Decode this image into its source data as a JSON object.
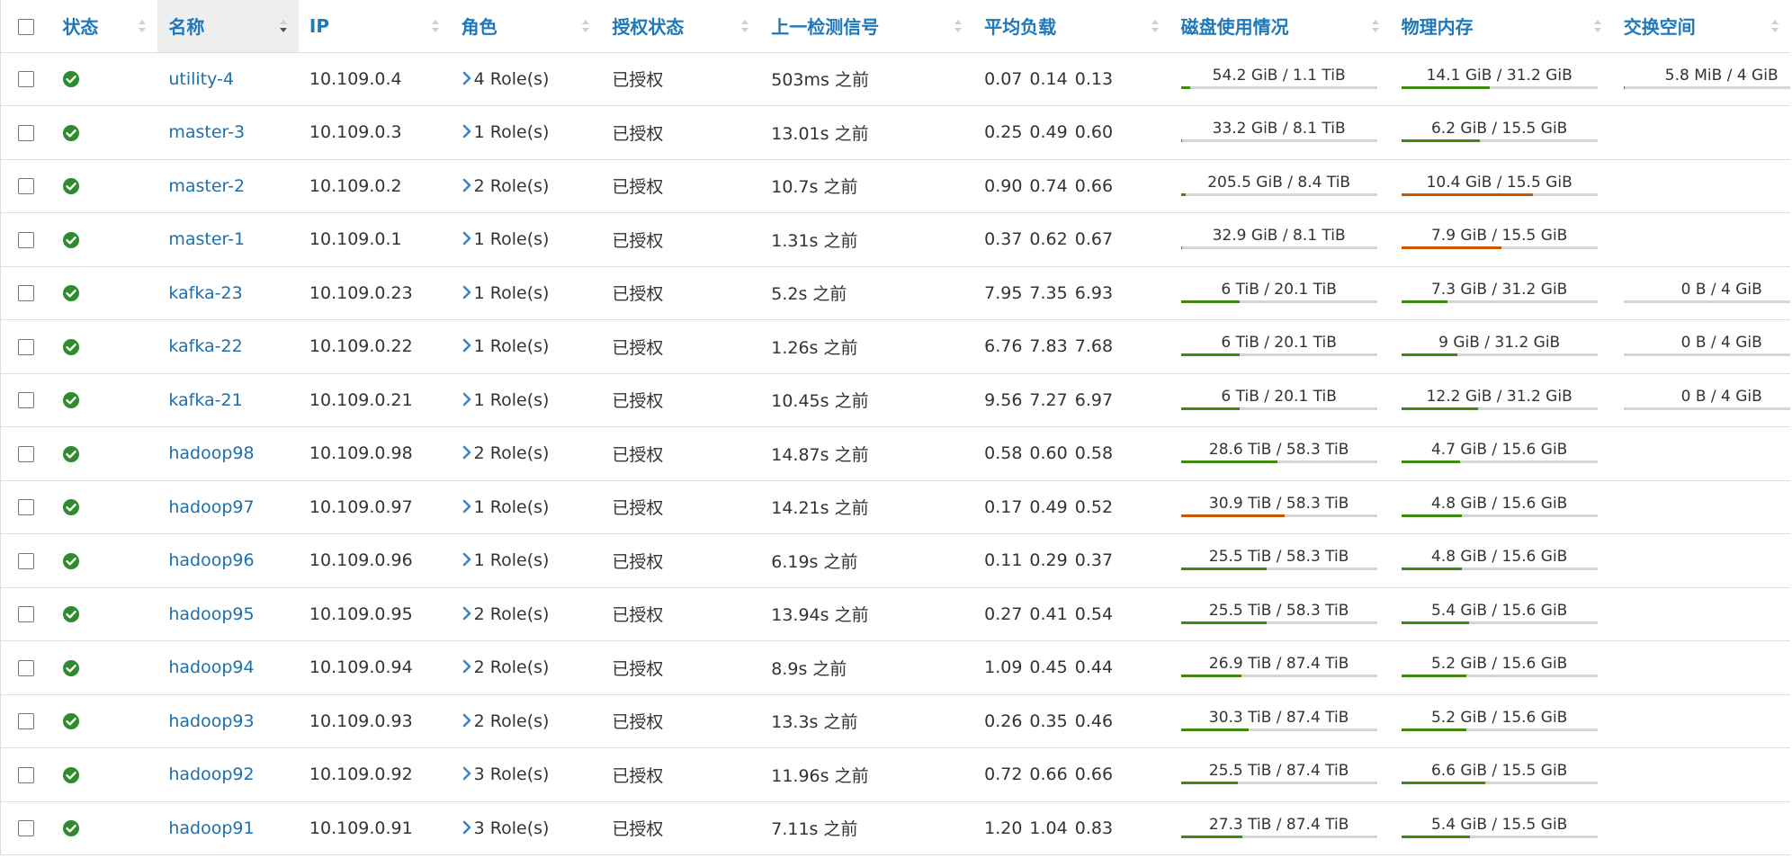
{
  "colors": {
    "header_text": "#1f78b8",
    "link": "#1f6fa8",
    "ok": "#2e8b2e",
    "bar_normal": "#3d8a0e",
    "bar_warning": "#cc5500",
    "bar_track": "#d5d5d5"
  },
  "columns": [
    {
      "key": "status",
      "label": "状态"
    },
    {
      "key": "name",
      "label": "名称",
      "sorted": "desc"
    },
    {
      "key": "ip",
      "label": "IP"
    },
    {
      "key": "roles",
      "label": "角色"
    },
    {
      "key": "auth",
      "label": "授权状态"
    },
    {
      "key": "heartbeat",
      "label": "上一检测信号"
    },
    {
      "key": "load",
      "label": "平均负载"
    },
    {
      "key": "disk",
      "label": "磁盘使用情况"
    },
    {
      "key": "memory",
      "label": "物理内存"
    },
    {
      "key": "swap",
      "label": "交换空间"
    }
  ],
  "status_icon": "check-circle-icon",
  "rows": [
    {
      "name": "utility-4",
      "ip": "10.109.0.4",
      "roles": "4 Role(s)",
      "auth": "已授权",
      "heartbeat": "503ms 之前",
      "load": [
        "0.07",
        "0.14",
        "0.13"
      ],
      "disk": {
        "text": "54.2 GiB / 1.1 TiB",
        "pct": 4.8,
        "warn": false
      },
      "memory": {
        "text": "14.1 GiB / 31.2 GiB",
        "pct": 45,
        "warn": false
      },
      "swap": {
        "text": "5.8 MiB / 4 GiB",
        "pct": 0.5,
        "warn": false
      }
    },
    {
      "name": "master-3",
      "ip": "10.109.0.3",
      "roles": "1 Role(s)",
      "auth": "已授权",
      "heartbeat": "13.01s 之前",
      "load": [
        "0.25",
        "0.49",
        "0.60"
      ],
      "disk": {
        "text": "33.2 GiB / 8.1 TiB",
        "pct": 0.4,
        "warn": false
      },
      "memory": {
        "text": "6.2 GiB / 15.5 GiB",
        "pct": 40,
        "warn": false
      },
      "swap": null
    },
    {
      "name": "master-2",
      "ip": "10.109.0.2",
      "roles": "2 Role(s)",
      "auth": "已授权",
      "heartbeat": "10.7s 之前",
      "load": [
        "0.90",
        "0.74",
        "0.66"
      ],
      "disk": {
        "text": "205.5 GiB / 8.4 TiB",
        "pct": 2.4,
        "warn": false
      },
      "memory": {
        "text": "10.4 GiB / 15.5 GiB",
        "pct": 67,
        "warn": true
      },
      "swap": null
    },
    {
      "name": "master-1",
      "ip": "10.109.0.1",
      "roles": "1 Role(s)",
      "auth": "已授权",
      "heartbeat": "1.31s 之前",
      "load": [
        "0.37",
        "0.62",
        "0.67"
      ],
      "disk": {
        "text": "32.9 GiB / 8.1 TiB",
        "pct": 0.4,
        "warn": false
      },
      "memory": {
        "text": "7.9 GiB / 15.5 GiB",
        "pct": 51,
        "warn": true
      },
      "swap": null
    },
    {
      "name": "kafka-23",
      "ip": "10.109.0.23",
      "roles": "1 Role(s)",
      "auth": "已授权",
      "heartbeat": "5.2s 之前",
      "load": [
        "7.95",
        "7.35",
        "6.93"
      ],
      "disk": {
        "text": "6 TiB / 20.1 TiB",
        "pct": 29.9,
        "warn": false
      },
      "memory": {
        "text": "7.3 GiB / 31.2 GiB",
        "pct": 23.4,
        "warn": false
      },
      "swap": {
        "text": "0 B / 4 GiB",
        "pct": 0,
        "warn": false
      }
    },
    {
      "name": "kafka-22",
      "ip": "10.109.0.22",
      "roles": "1 Role(s)",
      "auth": "已授权",
      "heartbeat": "1.26s 之前",
      "load": [
        "6.76",
        "7.83",
        "7.68"
      ],
      "disk": {
        "text": "6 TiB / 20.1 TiB",
        "pct": 29.9,
        "warn": false
      },
      "memory": {
        "text": "9 GiB / 31.2 GiB",
        "pct": 28.8,
        "warn": false
      },
      "swap": {
        "text": "0 B / 4 GiB",
        "pct": 0,
        "warn": false
      }
    },
    {
      "name": "kafka-21",
      "ip": "10.109.0.21",
      "roles": "1 Role(s)",
      "auth": "已授权",
      "heartbeat": "10.45s 之前",
      "load": [
        "9.56",
        "7.27",
        "6.97"
      ],
      "disk": {
        "text": "6 TiB / 20.1 TiB",
        "pct": 29.9,
        "warn": false
      },
      "memory": {
        "text": "12.2 GiB / 31.2 GiB",
        "pct": 39.1,
        "warn": false
      },
      "swap": {
        "text": "0 B / 4 GiB",
        "pct": 0,
        "warn": false
      }
    },
    {
      "name": "hadoop98",
      "ip": "10.109.0.98",
      "roles": "2 Role(s)",
      "auth": "已授权",
      "heartbeat": "14.87s 之前",
      "load": [
        "0.58",
        "0.60",
        "0.58"
      ],
      "disk": {
        "text": "28.6 TiB / 58.3 TiB",
        "pct": 49.1,
        "warn": false
      },
      "memory": {
        "text": "4.7 GiB / 15.6 GiB",
        "pct": 30.1,
        "warn": false
      },
      "swap": null
    },
    {
      "name": "hadoop97",
      "ip": "10.109.0.97",
      "roles": "1 Role(s)",
      "auth": "已授权",
      "heartbeat": "14.21s 之前",
      "load": [
        "0.17",
        "0.49",
        "0.52"
      ],
      "disk": {
        "text": "30.9 TiB / 58.3 TiB",
        "pct": 53,
        "warn": true
      },
      "memory": {
        "text": "4.8 GiB / 15.6 GiB",
        "pct": 30.8,
        "warn": false
      },
      "swap": null
    },
    {
      "name": "hadoop96",
      "ip": "10.109.0.96",
      "roles": "1 Role(s)",
      "auth": "已授权",
      "heartbeat": "6.19s 之前",
      "load": [
        "0.11",
        "0.29",
        "0.37"
      ],
      "disk": {
        "text": "25.5 TiB / 58.3 TiB",
        "pct": 43.7,
        "warn": false
      },
      "memory": {
        "text": "4.8 GiB / 15.6 GiB",
        "pct": 30.8,
        "warn": false
      },
      "swap": null
    },
    {
      "name": "hadoop95",
      "ip": "10.109.0.95",
      "roles": "2 Role(s)",
      "auth": "已授权",
      "heartbeat": "13.94s 之前",
      "load": [
        "0.27",
        "0.41",
        "0.54"
      ],
      "disk": {
        "text": "25.5 TiB / 58.3 TiB",
        "pct": 43.7,
        "warn": false
      },
      "memory": {
        "text": "5.4 GiB / 15.6 GiB",
        "pct": 34.6,
        "warn": false
      },
      "swap": null
    },
    {
      "name": "hadoop94",
      "ip": "10.109.0.94",
      "roles": "2 Role(s)",
      "auth": "已授权",
      "heartbeat": "8.9s 之前",
      "load": [
        "1.09",
        "0.45",
        "0.44"
      ],
      "disk": {
        "text": "26.9 TiB / 87.4 TiB",
        "pct": 30.8,
        "warn": false
      },
      "memory": {
        "text": "5.2 GiB / 15.6 GiB",
        "pct": 33.3,
        "warn": false
      },
      "swap": null
    },
    {
      "name": "hadoop93",
      "ip": "10.109.0.93",
      "roles": "2 Role(s)",
      "auth": "已授权",
      "heartbeat": "13.3s 之前",
      "load": [
        "0.26",
        "0.35",
        "0.46"
      ],
      "disk": {
        "text": "30.3 TiB / 87.4 TiB",
        "pct": 34.7,
        "warn": false
      },
      "memory": {
        "text": "5.2 GiB / 15.6 GiB",
        "pct": 33.3,
        "warn": false
      },
      "swap": null
    },
    {
      "name": "hadoop92",
      "ip": "10.109.0.92",
      "roles": "3 Role(s)",
      "auth": "已授权",
      "heartbeat": "11.96s 之前",
      "load": [
        "0.72",
        "0.66",
        "0.66"
      ],
      "disk": {
        "text": "25.5 TiB / 87.4 TiB",
        "pct": 29.2,
        "warn": false
      },
      "memory": {
        "text": "6.6 GiB / 15.5 GiB",
        "pct": 42.6,
        "warn": false
      },
      "swap": null
    },
    {
      "name": "hadoop91",
      "ip": "10.109.0.91",
      "roles": "3 Role(s)",
      "auth": "已授权",
      "heartbeat": "7.11s 之前",
      "load": [
        "1.20",
        "1.04",
        "0.83"
      ],
      "disk": {
        "text": "27.3 TiB / 87.4 TiB",
        "pct": 31.2,
        "warn": false
      },
      "memory": {
        "text": "5.4 GiB / 15.5 GiB",
        "pct": 34.8,
        "warn": false
      },
      "swap": null
    }
  ]
}
